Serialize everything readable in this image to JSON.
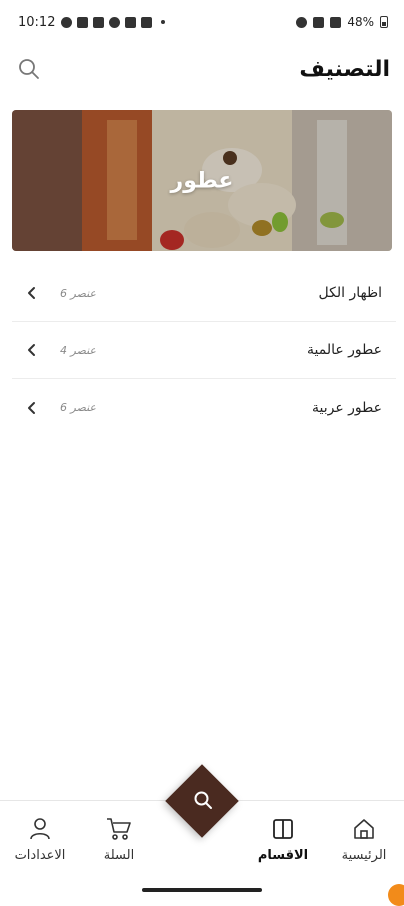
{
  "status_bar": {
    "time": "10:12",
    "battery": "48%"
  },
  "header": {
    "title": "التصنيف"
  },
  "banner": {
    "label": "عطور"
  },
  "categories": [
    {
      "name": "اظهار الكل",
      "count": "6 عنصر"
    },
    {
      "name": "عطور عالمية",
      "count": "4 عنصر"
    },
    {
      "name": "عطور عربية",
      "count": "6 عنصر"
    }
  ],
  "bottom_nav": {
    "home": "الرئيسية",
    "sections": "الاقسام",
    "cart": "السلة",
    "settings": "الاعدادات"
  },
  "colors": {
    "accent": "#4a2a20",
    "badge": "#f28b1a"
  }
}
